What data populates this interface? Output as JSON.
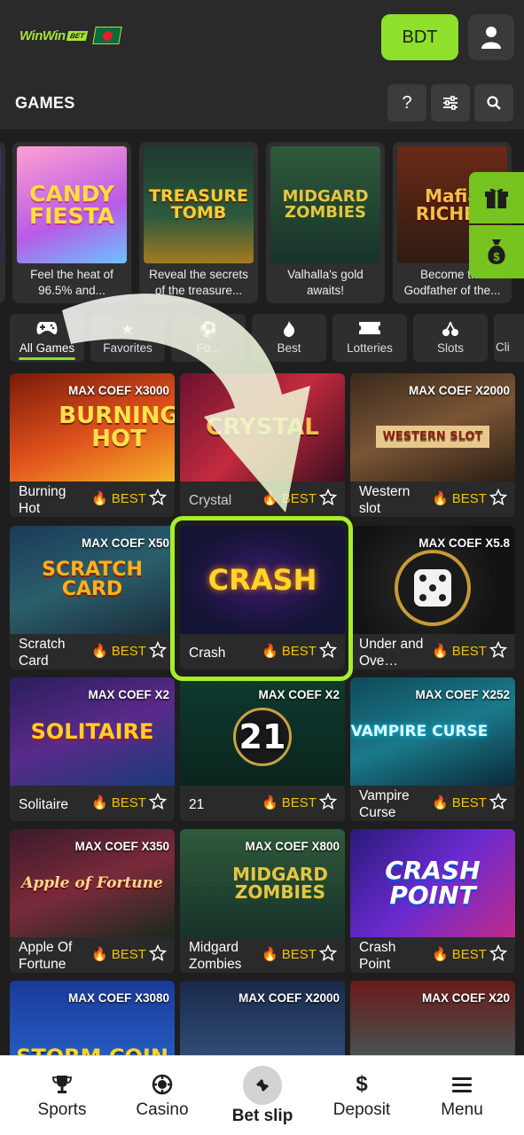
{
  "header": {
    "logo": "WinWin",
    "logo_badge": "BET",
    "currency": "BDT"
  },
  "games_bar": {
    "title": "GAMES",
    "help": "?"
  },
  "promos": [
    {
      "art": "CANDY FIESTA",
      "caption": "Feel the heat of 96.5% and..."
    },
    {
      "art": "TREASURE TOMB",
      "caption": "Reveal the secrets of the treasure..."
    },
    {
      "art": "MIDGARD ZOMBIES",
      "caption": "Valhalla's gold awaits!"
    },
    {
      "art": "Mafia RICHES",
      "caption": "Become the Godfather of the..."
    }
  ],
  "categories": [
    {
      "label": "All Games",
      "icon": "gamepad-icon",
      "active": true
    },
    {
      "label": "Favorites",
      "icon": "star-icon"
    },
    {
      "label": "Fo...",
      "icon": "football-icon"
    },
    {
      "label": "Best",
      "icon": "fire-icon"
    },
    {
      "label": "Lotteries",
      "icon": "ticket-icon"
    },
    {
      "label": "Slots",
      "icon": "cherry-icon"
    },
    {
      "label": "Cli",
      "icon": "generic-icon"
    }
  ],
  "games": [
    {
      "name": "Burning Hot",
      "coef": "MAX COEF X3000",
      "art": "BURNING HOT",
      "best": "BEST"
    },
    {
      "name": "Crystal",
      "coef": "",
      "art": "CRYSTAL",
      "best": "BEST"
    },
    {
      "name": "Western slot",
      "coef": "MAX COEF X2000",
      "art": "WESTERN SLOT",
      "best": "BEST"
    },
    {
      "name": "Scratch Card",
      "coef": "MAX COEF X50",
      "art": "SCRATCH CARD",
      "best": "BEST"
    },
    {
      "name": "Crash",
      "coef": "",
      "art": "CRASH",
      "best": "BEST"
    },
    {
      "name": "Under and Ove…",
      "coef": "MAX COEF X5.8",
      "art": "",
      "best": "BEST"
    },
    {
      "name": "Solitaire",
      "coef": "MAX COEF X2",
      "art": "SOLITAIRE",
      "best": "BEST"
    },
    {
      "name": "21",
      "coef": "MAX COEF X2",
      "art": "21",
      "best": "BEST"
    },
    {
      "name": "Vampire Curse",
      "coef": "MAX COEF X252",
      "art": "VAMPIRE CURSE",
      "best": "BEST"
    },
    {
      "name": "Apple Of Fortune",
      "coef": "MAX COEF X350",
      "art": "Apple of Fortune",
      "best": "BEST"
    },
    {
      "name": "Midgard Zombies",
      "coef": "MAX COEF X800",
      "art": "MIDGARD ZOMBIES",
      "best": "BEST"
    },
    {
      "name": "Crash Point",
      "coef": "",
      "art": "CRASH POINT",
      "best": "BEST"
    },
    {
      "name": "",
      "coef": "MAX COEF X3080",
      "art": "STORM COIN",
      "best": ""
    },
    {
      "name": "",
      "coef": "MAX COEF X2000",
      "art": "",
      "best": ""
    },
    {
      "name": "",
      "coef": "MAX COEF X20",
      "art": "",
      "best": ""
    }
  ],
  "bottom_nav": [
    {
      "label": "Sports",
      "icon": "trophy-icon"
    },
    {
      "label": "Casino",
      "icon": "chip-icon"
    },
    {
      "label": "Bet slip",
      "icon": "ticket-icon",
      "active": true
    },
    {
      "label": "Deposit",
      "icon": "dollar-icon"
    },
    {
      "label": "Menu",
      "icon": "hamburger-icon"
    }
  ],
  "colors": {
    "accent": "#8ee02a",
    "best": "#f4c300",
    "background": "#1e1e1e"
  }
}
